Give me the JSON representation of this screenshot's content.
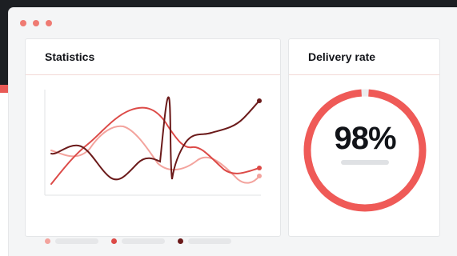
{
  "window": {
    "controls": [
      "dot",
      "dot",
      "dot"
    ]
  },
  "statistics": {
    "title": "Statistics",
    "legend": [
      {
        "color": "#f3a39d"
      },
      {
        "color": "#dc4a47"
      },
      {
        "color": "#6b1a1a"
      }
    ]
  },
  "delivery": {
    "title": "Delivery rate",
    "value_text": "98%",
    "value": 98
  },
  "colors": {
    "accent": "#ef5a57",
    "light_series": "#f3a39d",
    "mid_series": "#dc4a47",
    "dark_series": "#6b1a1a"
  }
}
